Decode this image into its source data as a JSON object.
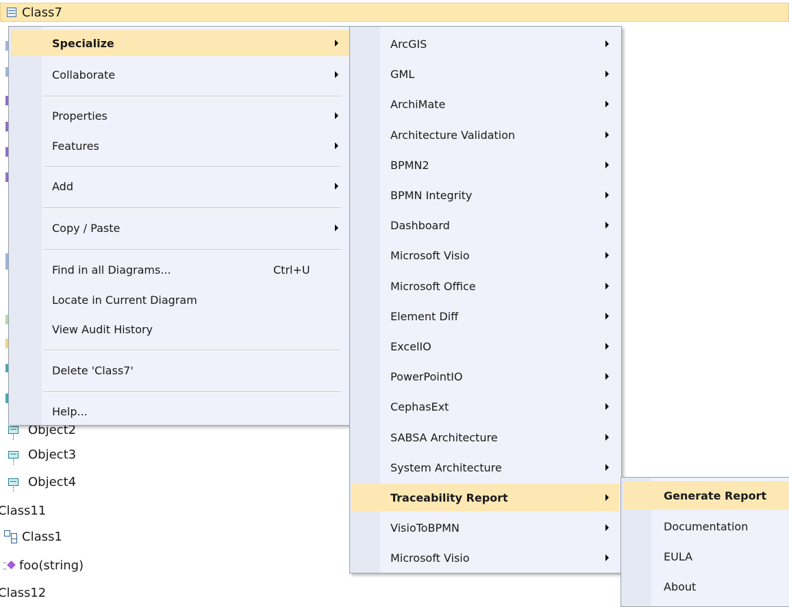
{
  "tree": {
    "selected_item": "Class7",
    "items": [
      {
        "label": "Object2",
        "icon": "object-icon"
      },
      {
        "label": "Object3",
        "icon": "object-icon"
      },
      {
        "label": "Object4",
        "icon": "object-icon"
      },
      {
        "label": "Class11",
        "icon": "class-icon"
      },
      {
        "label": "Class1",
        "icon": "class-diagram-icon"
      },
      {
        "label": "foo(string)",
        "icon": "method-icon"
      },
      {
        "label": "Class12",
        "icon": "class-icon"
      }
    ]
  },
  "context_menu": {
    "items": [
      {
        "label": "Specialize",
        "submenu": true,
        "highlighted": true
      },
      {
        "label": "Collaborate",
        "submenu": true
      },
      {
        "label": "Properties",
        "submenu": true
      },
      {
        "label": "Features",
        "submenu": true
      },
      {
        "label": "Add",
        "submenu": true
      },
      {
        "label": "Copy / Paste",
        "submenu": true
      },
      {
        "label": "Find in all Diagrams...",
        "shortcut": "Ctrl+U"
      },
      {
        "label": "Locate in Current Diagram"
      },
      {
        "label": "View Audit History"
      },
      {
        "label": "Delete 'Class7'"
      },
      {
        "label": "Help..."
      }
    ]
  },
  "specialize_menu": {
    "items": [
      {
        "label": "ArcGIS",
        "submenu": true
      },
      {
        "label": "GML",
        "submenu": true
      },
      {
        "label": "ArchiMate",
        "submenu": true
      },
      {
        "label": "Architecture Validation",
        "submenu": true
      },
      {
        "label": "BPMN2",
        "submenu": true
      },
      {
        "label": "BPMN Integrity",
        "submenu": true
      },
      {
        "label": "Dashboard",
        "submenu": true
      },
      {
        "label": "Microsoft Visio",
        "submenu": true
      },
      {
        "label": "Microsoft Office",
        "submenu": true
      },
      {
        "label": "Element Diff",
        "submenu": true
      },
      {
        "label": "ExcelIO",
        "submenu": true
      },
      {
        "label": "PowerPointIO",
        "submenu": true
      },
      {
        "label": "CephasExt",
        "submenu": true
      },
      {
        "label": "SABSA Architecture",
        "submenu": true
      },
      {
        "label": "System Architecture",
        "submenu": true
      },
      {
        "label": "Traceability Report",
        "submenu": true,
        "highlighted": true
      },
      {
        "label": "VisioToBPMN",
        "submenu": true
      },
      {
        "label": "Microsoft Visio",
        "submenu": true
      }
    ]
  },
  "traceability_menu": {
    "items": [
      {
        "label": "Generate Report",
        "highlighted": true
      },
      {
        "label": "Documentation"
      },
      {
        "label": "EULA"
      },
      {
        "label": "About"
      }
    ]
  },
  "colors": {
    "menu_bg": "#eff2fa",
    "highlight": "#fde8b3",
    "selected_row": "#fde9b0"
  }
}
